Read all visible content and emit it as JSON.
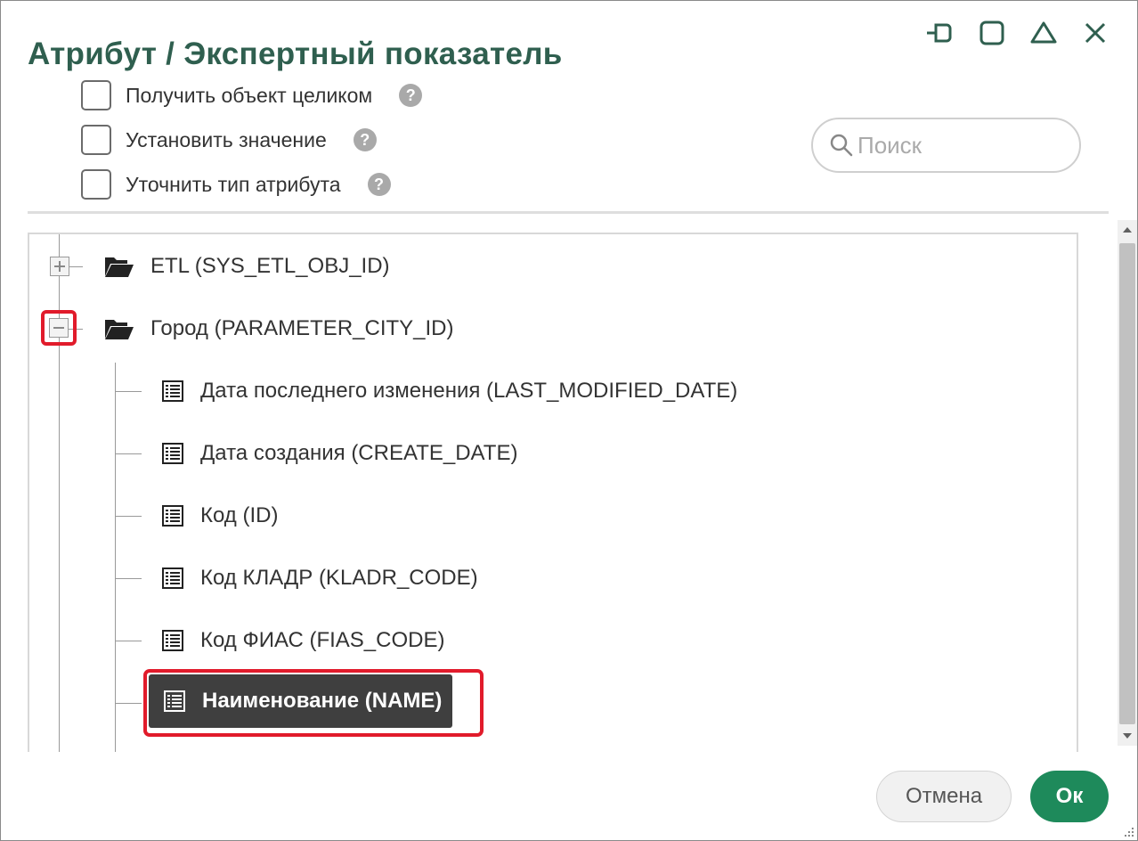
{
  "dialog": {
    "title": "Атрибут / Экспертный показатель"
  },
  "options": [
    {
      "label": "Получить объект целиком",
      "checked": false
    },
    {
      "label": "Установить значение",
      "checked": false
    },
    {
      "label": "Уточнить тип атрибута",
      "checked": false
    }
  ],
  "help_icon_text": "?",
  "search": {
    "placeholder": "Поиск",
    "value": ""
  },
  "tree": {
    "groups": [
      {
        "label": "ETL (SYS_ETL_OBJ_ID)",
        "expanded": false,
        "icon": "folder-open-icon"
      },
      {
        "label": "Город (PARAMETER_CITY_ID)",
        "expanded": true,
        "icon": "folder-open-icon"
      }
    ],
    "children": [
      {
        "label": "Дата последнего изменения (LAST_MODIFIED_DATE)",
        "icon": "list-icon"
      },
      {
        "label": "Дата создания (CREATE_DATE)",
        "icon": "list-icon"
      },
      {
        "label": "Код (ID)",
        "icon": "list-icon"
      },
      {
        "label": "Код КЛАДР (KLADR_CODE)",
        "icon": "list-icon"
      },
      {
        "label": "Код ФИАС (FIAS_CODE)",
        "icon": "list-icon"
      },
      {
        "label": "Наименование (NAME)",
        "icon": "list-icon",
        "selected": true
      }
    ]
  },
  "buttons": {
    "cancel": "Отмена",
    "ok": "Ок"
  },
  "colors": {
    "title": "#2f5f4f",
    "ok_button": "#1e8a5b",
    "highlight": "#e11b2b",
    "selected_row": "#3f3f3f"
  }
}
